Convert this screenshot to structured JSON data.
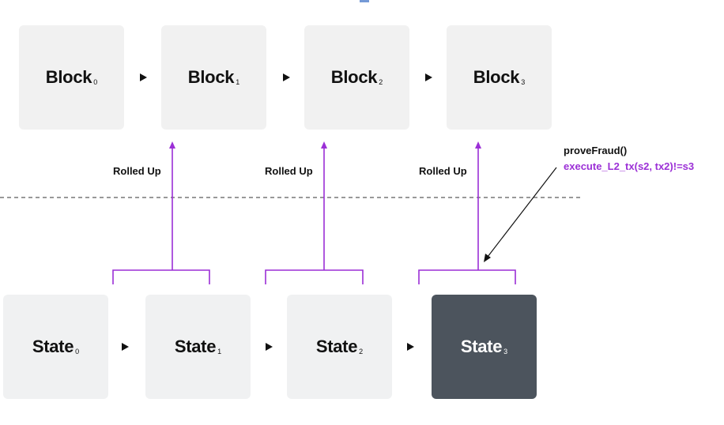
{
  "diagram": {
    "blocks": [
      {
        "label": "Block",
        "subscript": "0"
      },
      {
        "label": "Block",
        "subscript": "1"
      },
      {
        "label": "Block",
        "subscript": "2"
      },
      {
        "label": "Block",
        "subscript": "3"
      }
    ],
    "states": [
      {
        "label": "State",
        "subscript": "0"
      },
      {
        "label": "State",
        "subscript": "1"
      },
      {
        "label": "State",
        "subscript": "2"
      },
      {
        "label": "State",
        "subscript": "3",
        "highlighted": true
      }
    ],
    "rollup_labels": [
      "Rolled Up",
      "Rolled Up",
      "Rolled Up"
    ],
    "fraud_annotation": {
      "title": "proveFraud()",
      "expression": "execute_L2_tx(s2, tx2)!=s3"
    },
    "colors": {
      "rollup_arrow": "#9b2fd6",
      "highlight_box": "#4c545d",
      "box": "#f1f1f1"
    }
  }
}
